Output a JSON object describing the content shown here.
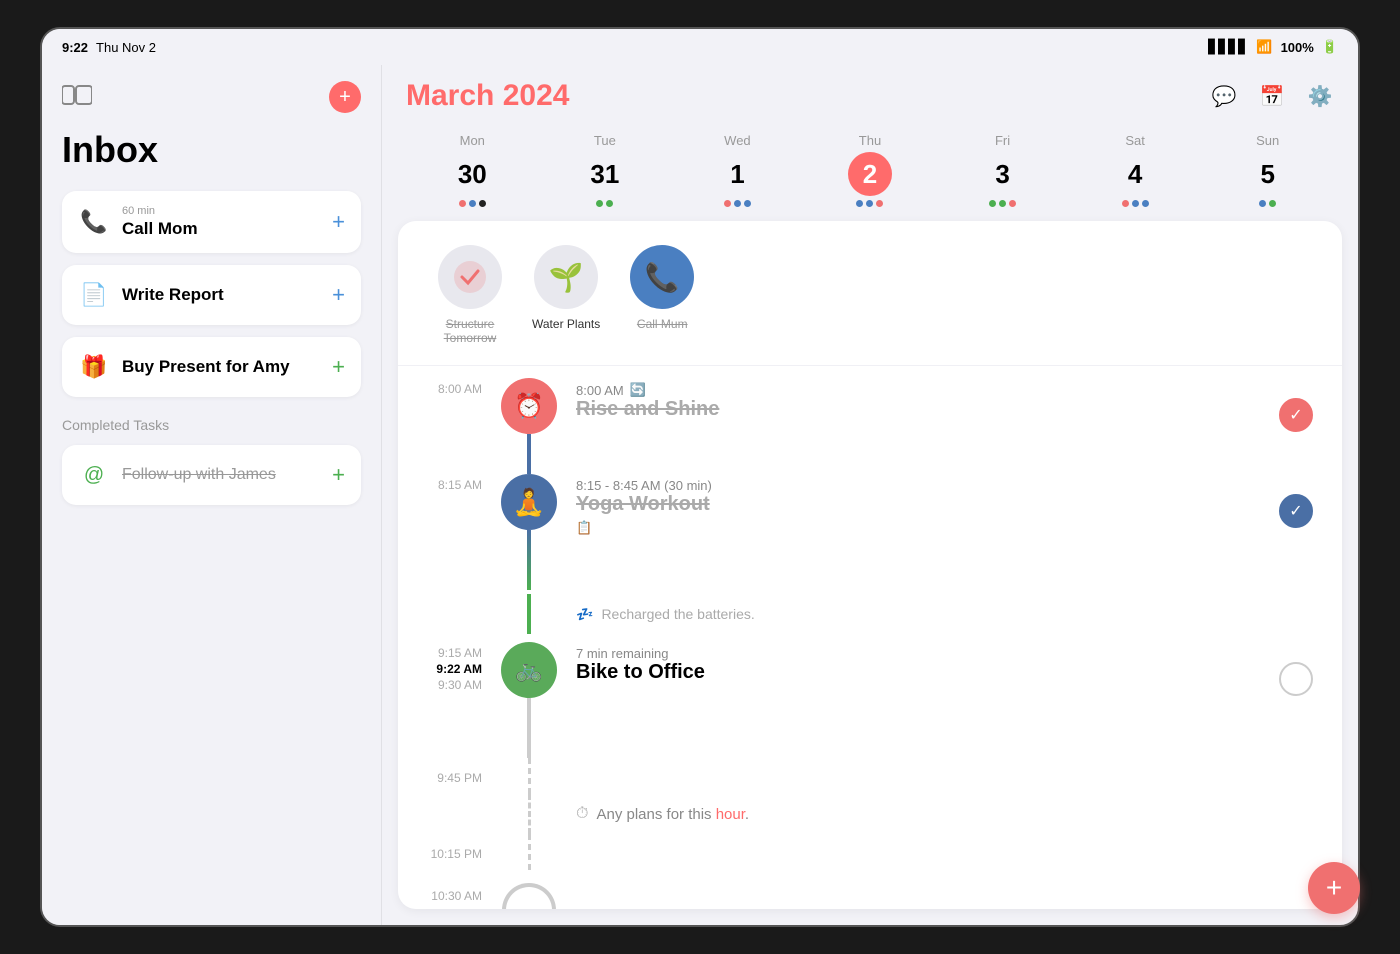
{
  "statusBar": {
    "time": "9:22",
    "day": "Thu Nov 2",
    "battery": "100%"
  },
  "sidebar": {
    "inboxTitle": "Inbox",
    "tasks": [
      {
        "icon": "📞",
        "iconColor": "#f07070",
        "duration": "60 min",
        "name": "Call Mom",
        "addColor": "blue"
      },
      {
        "icon": "📄",
        "iconColor": "#4a7fc1",
        "duration": null,
        "name": "Write Report",
        "addColor": "blue"
      },
      {
        "icon": "🎁",
        "iconColor": "#4caf50",
        "duration": null,
        "name": "Buy Present for Amy",
        "addColor": "green"
      }
    ],
    "completedTitle": "Completed Tasks",
    "completedTasks": [
      {
        "icon": "@",
        "iconColor": "#4caf50",
        "name": "Follow-up with James"
      }
    ]
  },
  "calendar": {
    "month": "March",
    "year": "2024",
    "days": [
      {
        "name": "Mon",
        "number": "30",
        "isToday": false,
        "dots": [
          "#f07070",
          "#4a7fc1",
          "#000"
        ]
      },
      {
        "name": "Tue",
        "number": "31",
        "isToday": false,
        "dots": [
          "#4caf50",
          "#4caf50"
        ]
      },
      {
        "name": "Wed",
        "number": "1",
        "isToday": false,
        "dots": [
          "#f07070",
          "#4a7fc1",
          "#4a7fc1"
        ]
      },
      {
        "name": "Thu",
        "number": "2",
        "isToday": true,
        "dots": [
          "#4a7fc1",
          "#4a7fc1",
          "#f07070"
        ]
      },
      {
        "name": "Fri",
        "number": "3",
        "isToday": false,
        "dots": [
          "#4caf50",
          "#4caf50",
          "#f07070"
        ]
      },
      {
        "name": "Sat",
        "number": "4",
        "isToday": false,
        "dots": [
          "#f07070",
          "#4a7fc1",
          "#4a7fc1"
        ]
      },
      {
        "name": "Sun",
        "number": "5",
        "isToday": false,
        "dots": [
          "#4a7fc1",
          "#4caf50"
        ]
      }
    ],
    "chips": [
      {
        "icon": "✅",
        "bg": "#e8e8ee",
        "label": "Structure Tomorrow",
        "done": true
      },
      {
        "icon": "🌱",
        "bg": "#e8e8ee",
        "label": "Water Plants",
        "done": false
      },
      {
        "icon": "📞",
        "bg": "#4a7fc1",
        "label": "Call Mum",
        "done": true
      }
    ],
    "events": [
      {
        "timeLabel": "8:00 AM",
        "timeDisplay": "8:00 AM",
        "iconColor": "pink",
        "iconEmoji": "⏰",
        "name": "Rise and Shine",
        "done": true,
        "checkType": "checked-pink",
        "hasRepeat": true
      },
      {
        "timeLabel": "8:15 AM",
        "timeDisplay": "8:15 - 8:45 AM (30 min)",
        "iconColor": "blue-dark",
        "iconEmoji": "🧘",
        "name": "Yoga Workout",
        "done": true,
        "checkType": "checked-blue",
        "note": "Recharged the batteries.",
        "hasCalIcon": true
      },
      {
        "timeLabel": "9:15 AM",
        "timeLabelBold": "9:22 AM",
        "timeLabel2": "9:30 AM",
        "timeDisplay": "7 min remaining",
        "iconColor": "green",
        "iconEmoji": "🚲",
        "name": "Bike to Office",
        "done": false,
        "checkType": "empty"
      }
    ],
    "emptyHours": [
      "9:45 PM",
      "10:15 PM",
      "10:30 AM"
    ],
    "plansText": "Any plans for this",
    "plansHighlight": "hour",
    "plansEnd": "."
  }
}
